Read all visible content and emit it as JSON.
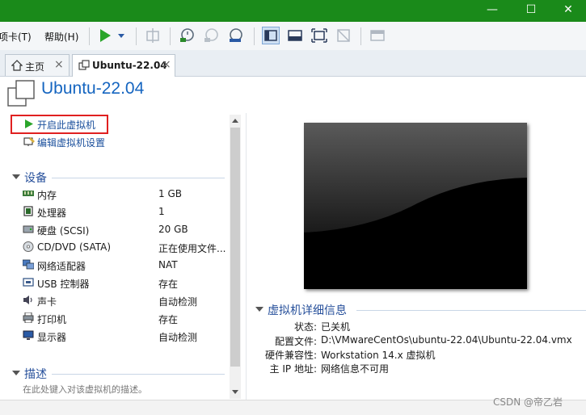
{
  "window": {
    "minimize_glyph": "—",
    "maximize_glyph": "☐",
    "close_glyph": "✕"
  },
  "menu": {
    "items": [
      "项卡(T)",
      "帮助(H)"
    ]
  },
  "tabs": [
    {
      "label": "主页",
      "close": "×",
      "icon": "home-icon"
    },
    {
      "label": "Ubuntu-22.04",
      "close": "×",
      "icon": "vm-icon"
    }
  ],
  "page": {
    "title": "Ubuntu-22.04"
  },
  "actions": [
    {
      "label": "开启此虚拟机",
      "icon": "play-icon"
    },
    {
      "label": "编辑虚拟机设置",
      "icon": "settings-icon"
    }
  ],
  "devices": {
    "title": "设备",
    "items": [
      {
        "name": "内存",
        "value": "1 GB",
        "icon": "memory-icon"
      },
      {
        "name": "处理器",
        "value": "1",
        "icon": "cpu-icon"
      },
      {
        "name": "硬盘 (SCSI)",
        "value": "20 GB",
        "icon": "disk-icon"
      },
      {
        "name": "CD/DVD (SATA)",
        "value": "正在使用文件...",
        "icon": "cd-icon"
      },
      {
        "name": "网络适配器",
        "value": "NAT",
        "icon": "network-icon"
      },
      {
        "name": "USB 控制器",
        "value": "存在",
        "icon": "usb-icon"
      },
      {
        "name": "声卡",
        "value": "自动检测",
        "icon": "sound-icon"
      },
      {
        "name": "打印机",
        "value": "存在",
        "icon": "printer-icon"
      },
      {
        "name": "显示器",
        "value": "自动检测",
        "icon": "display-icon"
      }
    ]
  },
  "description": {
    "title": "描述",
    "placeholder": "在此处键入对该虚拟机的描述。"
  },
  "details": {
    "title": "虚拟机详细信息",
    "rows": [
      {
        "label": "状态:",
        "value": "已关机"
      },
      {
        "label": "配置文件:",
        "value": "D:\\VMwareCentOs\\ubuntu-22.04\\Ubuntu-22.04.vmx"
      },
      {
        "label": "硬件兼容性:",
        "value": "Workstation 14.x 虚拟机"
      },
      {
        "label": "主 IP 地址:",
        "value": "网络信息不可用"
      }
    ]
  },
  "watermark": "CSDN @帝乙岩",
  "colors": {
    "titlebar": "#1a8a1a",
    "accent": "#1565c0",
    "highlight_box": "#e02020",
    "play_green": "#2aa52a"
  }
}
